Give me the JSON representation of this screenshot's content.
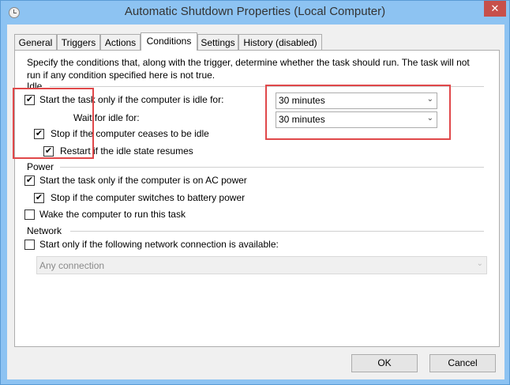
{
  "window": {
    "title": "Automatic Shutdown Properties (Local Computer)",
    "close": "✕"
  },
  "tabs": [
    "General",
    "Triggers",
    "Actions",
    "Conditions",
    "Settings",
    "History (disabled)"
  ],
  "active_tab": "Conditions",
  "description": "Specify the conditions that, along with the trigger, determine whether the task should run.  The task will not run  if any condition specified here is not true.",
  "idle": {
    "label": "Idle",
    "start_if_idle": {
      "label": "Start the task only if the computer is idle for:",
      "checked": true
    },
    "idle_for_value": "30 minutes",
    "wait_label": "Wait for idle for:",
    "wait_value": "30 minutes",
    "stop_if_ceases": {
      "label": "Stop if the computer ceases to be idle",
      "checked": true
    },
    "restart": {
      "label": "Restart if the idle state resumes",
      "checked": true
    }
  },
  "power": {
    "label": "Power",
    "ac_power": {
      "label": "Start the task only if the computer is on AC power",
      "checked": true
    },
    "battery": {
      "label": "Stop if the computer switches to battery power",
      "checked": true
    },
    "wake": {
      "label": "Wake the computer to run this task",
      "checked": false
    }
  },
  "network": {
    "label": "Network",
    "start_only": {
      "label": "Start only if the following network connection is available:",
      "checked": false
    },
    "connection": "Any connection"
  },
  "buttons": {
    "ok": "OK",
    "cancel": "Cancel"
  },
  "check_glyph": "✔"
}
